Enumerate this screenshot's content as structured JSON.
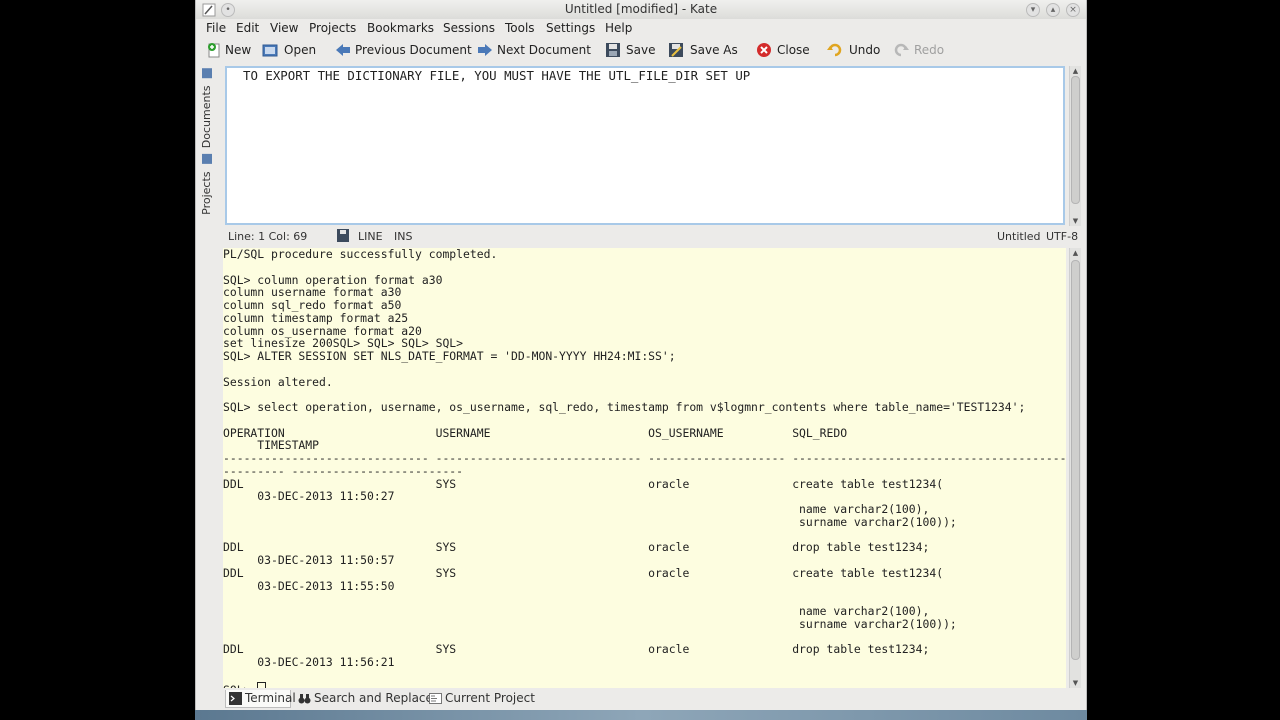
{
  "window": {
    "title": "Untitled [modified] - Kate"
  },
  "menu": [
    "File",
    "Edit",
    "View",
    "Projects",
    "Bookmarks",
    "Sessions",
    "Tools",
    "Settings",
    "Help"
  ],
  "toolbar": {
    "new": "New",
    "open": "Open",
    "previous": "Previous Document",
    "next": "Next Document",
    "save": "Save",
    "save_as": "Save As",
    "close": "Close",
    "undo": "Undo",
    "redo": "Redo"
  },
  "sidebar": {
    "documents": "Documents",
    "projects": "Projects"
  },
  "editor": {
    "text": "TO EXPORT THE DICTIONARY FILE, YOU MUST HAVE THE UTL_FILE_DIR SET UP"
  },
  "status": {
    "position": "Line: 1 Col: 69",
    "mode": "LINE",
    "insert": "INS",
    "doc_name": "Untitled",
    "encoding": "UTF-8"
  },
  "terminal": {
    "lines": [
      "PL/SQL procedure successfully completed.",
      "",
      "SQL> column operation format a30",
      "column username format a30",
      "column sql_redo format a50",
      "column timestamp format a25",
      "column os_username format a20",
      "set linesize 200SQL> SQL> SQL> SQL>",
      "SQL> ALTER SESSION SET NLS_DATE_FORMAT = 'DD-MON-YYYY HH24:MI:SS';",
      "",
      "Session altered.",
      "",
      "SQL> select operation, username, os_username, sql_redo, timestamp from v$logmnr_contents where table_name='TEST1234';",
      "",
      "OPERATION                      USERNAME                       OS_USERNAME          SQL_REDO",
      "     TIMESTAMP",
      "------------------------------ ------------------------------ -------------------- --------------------------------------------------",
      "--------- -------------------------",
      "DDL                            SYS                            oracle               create table test1234(",
      "     03-DEC-2013 11:50:27",
      "                                                                                    name varchar2(100),",
      "                                                                                    surname varchar2(100));",
      "",
      "DDL                            SYS                            oracle               drop table test1234;",
      "     03-DEC-2013 11:50:57",
      "DDL                            SYS                            oracle               create table test1234(",
      "     03-DEC-2013 11:55:50",
      "",
      "                                                                                    name varchar2(100),",
      "                                                                                    surname varchar2(100));",
      "",
      "DDL                            SYS                            oracle               drop table test1234;",
      "     03-DEC-2013 11:56:21",
      ""
    ],
    "prompt": "SQL> "
  },
  "bottom_tabs": {
    "terminal": "Terminal",
    "search": "Search and Replace",
    "project": "Current Project"
  }
}
